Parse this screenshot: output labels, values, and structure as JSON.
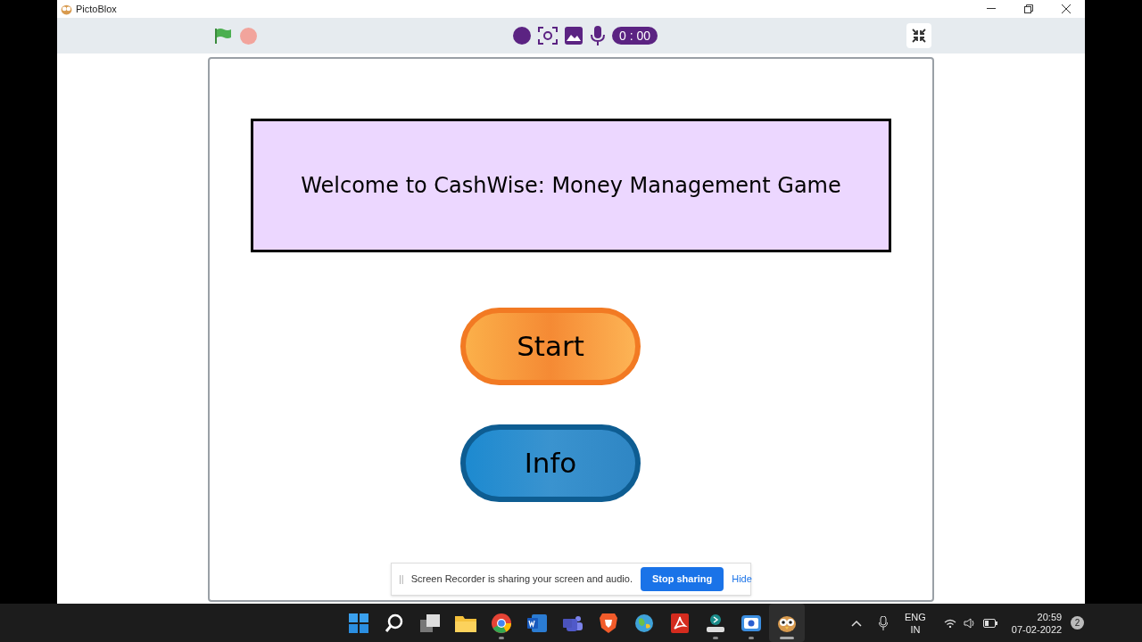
{
  "window": {
    "title": "PictoBlox"
  },
  "toolbar": {
    "timer": "0 : 00"
  },
  "stage": {
    "banner": "Welcome to CashWise: Money Management Game",
    "buttons": [
      {
        "label": "Start",
        "kind": "orange"
      },
      {
        "label": "Info",
        "kind": "blue"
      }
    ]
  },
  "share_bar": {
    "handle": "||",
    "message": "Screen Recorder is sharing your screen and audio.",
    "stop": "Stop sharing",
    "hide": "Hide"
  },
  "taskbar": {
    "apps": [
      {
        "kind": "start",
        "running": false,
        "selected": false
      },
      {
        "kind": "search",
        "running": false,
        "selected": false
      },
      {
        "kind": "taskview",
        "running": false,
        "selected": false
      },
      {
        "kind": "folder",
        "running": false,
        "selected": false
      },
      {
        "kind": "browser",
        "running": true,
        "selected": false
      },
      {
        "kind": "word",
        "running": false,
        "selected": false
      },
      {
        "kind": "teams",
        "running": false,
        "selected": false
      },
      {
        "kind": "shield",
        "running": false,
        "selected": false
      },
      {
        "kind": "globe",
        "running": false,
        "selected": false
      },
      {
        "kind": "pdf",
        "running": false,
        "selected": false
      },
      {
        "kind": "drive",
        "running": true,
        "selected": false
      },
      {
        "kind": "recorder",
        "running": true,
        "selected": false
      },
      {
        "kind": "owl",
        "running": true,
        "selected": true
      }
    ],
    "lang": "ENG",
    "region": "IN",
    "time": "20:59",
    "date": "07-02-2022",
    "notifications": "2"
  }
}
